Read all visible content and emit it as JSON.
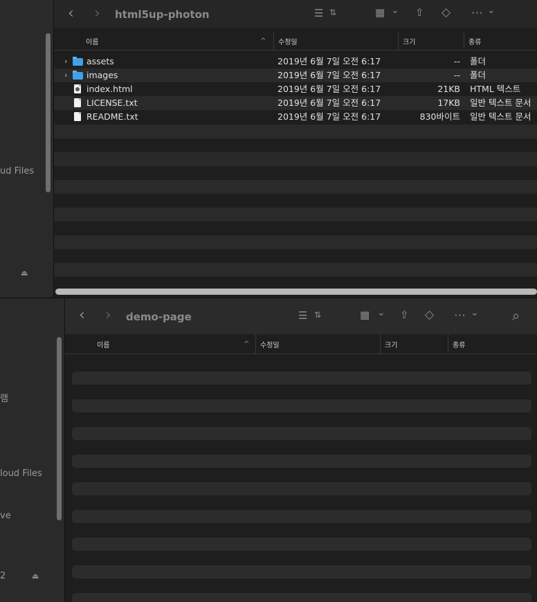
{
  "window1": {
    "title": "html5up-photon",
    "sidebar": {
      "partial_label": "ud Files"
    },
    "columns": {
      "name": "이름",
      "modified": "수정일",
      "size": "크기",
      "kind": "종류"
    },
    "rows": [
      {
        "name": "assets",
        "modified": "2019년 6월 7일 오전 6:17",
        "size": "--",
        "kind": "폴더",
        "icon": "folder-icon",
        "expandable": true
      },
      {
        "name": "images",
        "modified": "2019년 6월 7일 오전 6:17",
        "size": "--",
        "kind": "폴더",
        "icon": "folder-icon",
        "expandable": true
      },
      {
        "name": "index.html",
        "modified": "2019년 6월 7일 오전 6:17",
        "size": "21KB",
        "kind": "HTML 텍스트",
        "icon": "html-file-icon",
        "expandable": false
      },
      {
        "name": "LICENSE.txt",
        "modified": "2019년 6월 7일 오전 6:17",
        "size": "17KB",
        "kind": "일반 텍스트 문서",
        "icon": "text-file-icon",
        "expandable": false
      },
      {
        "name": "README.txt",
        "modified": "2019년 6월 7일 오전 6:17",
        "size": "830바이트",
        "kind": "일반 텍스트 문서",
        "icon": "text-file-icon",
        "expandable": false
      }
    ]
  },
  "window2": {
    "title": "demo-page",
    "sidebar": {
      "partial_label_1": "램",
      "partial_label_2": "loud Files",
      "partial_label_3": "ve",
      "partial_label_4": "2"
    },
    "columns": {
      "name": "이름",
      "modified": "수정일",
      "size": "크기",
      "kind": "종류"
    }
  },
  "icons": {
    "back": "‹",
    "forward": "›",
    "list_view": "☰",
    "updown": "⇅",
    "grid_view": "▦",
    "chevron_down": "⌄",
    "share": "⇧",
    "tag": "◇",
    "more": "⋯",
    "search": "⌕",
    "eject": "⏏",
    "sort_up": "^"
  },
  "colors": {
    "folder": "#42a0e6",
    "background": "#1e1e1e",
    "sidebar": "#2a2a2a",
    "stripe": "#2a2a2a"
  }
}
